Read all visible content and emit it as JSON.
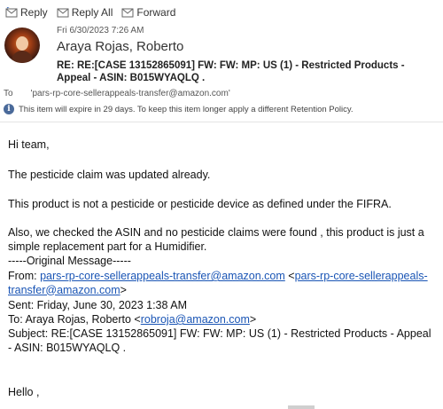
{
  "toolbar": {
    "reply": "Reply",
    "reply_all": "Reply All",
    "forward": "Forward"
  },
  "header": {
    "date": "Fri 6/30/2023 7:26 AM",
    "sender": "Araya Rojas, Roberto",
    "subject": "RE: RE:[CASE 13152865091] FW: FW: MP: US (1) - Restricted Products - Appeal - ASIN: B015WYAQLQ ."
  },
  "to_row": {
    "label": "To",
    "recipient": "'pars-rp-core-sellerappeals-transfer@amazon.com'"
  },
  "info": {
    "message": "This item will expire in 29 days. To keep this item longer apply a different Retention Policy."
  },
  "body": {
    "greeting": "Hi team,",
    "line1": "The pesticide claim was updated already.",
    "line2": "This product is not a pesticide or pesticide device as defined under the FIFRA.",
    "line3": "Also, we checked the ASIN and no pesticide claims were found , this product is just a simple replacement part for a Humidifier.",
    "original_header": "-----Original Message-----",
    "from_label": "From: ",
    "from_email": "pars-rp-core-sellerappeals-transfer@amazon.com",
    "from_email_bracket_open": " <",
    "from_email2_part1": "pars-rp-core-sellerappeals-",
    "from_email2_part2": "transfer@amazon.com",
    "from_email_bracket_close": ">",
    "sent": "Sent: Friday, June 30, 2023 1:38 AM",
    "to_label": "To: Araya Rojas, Roberto <",
    "to_email": "robroja@amazon.com",
    "to_close": ">",
    "subject": "Subject: RE:[CASE 13152865091] FW: FW: MP: US (1) - Restricted Products - Appeal - ASIN: B015WYAQLQ .",
    "hello": "Hello ,"
  }
}
